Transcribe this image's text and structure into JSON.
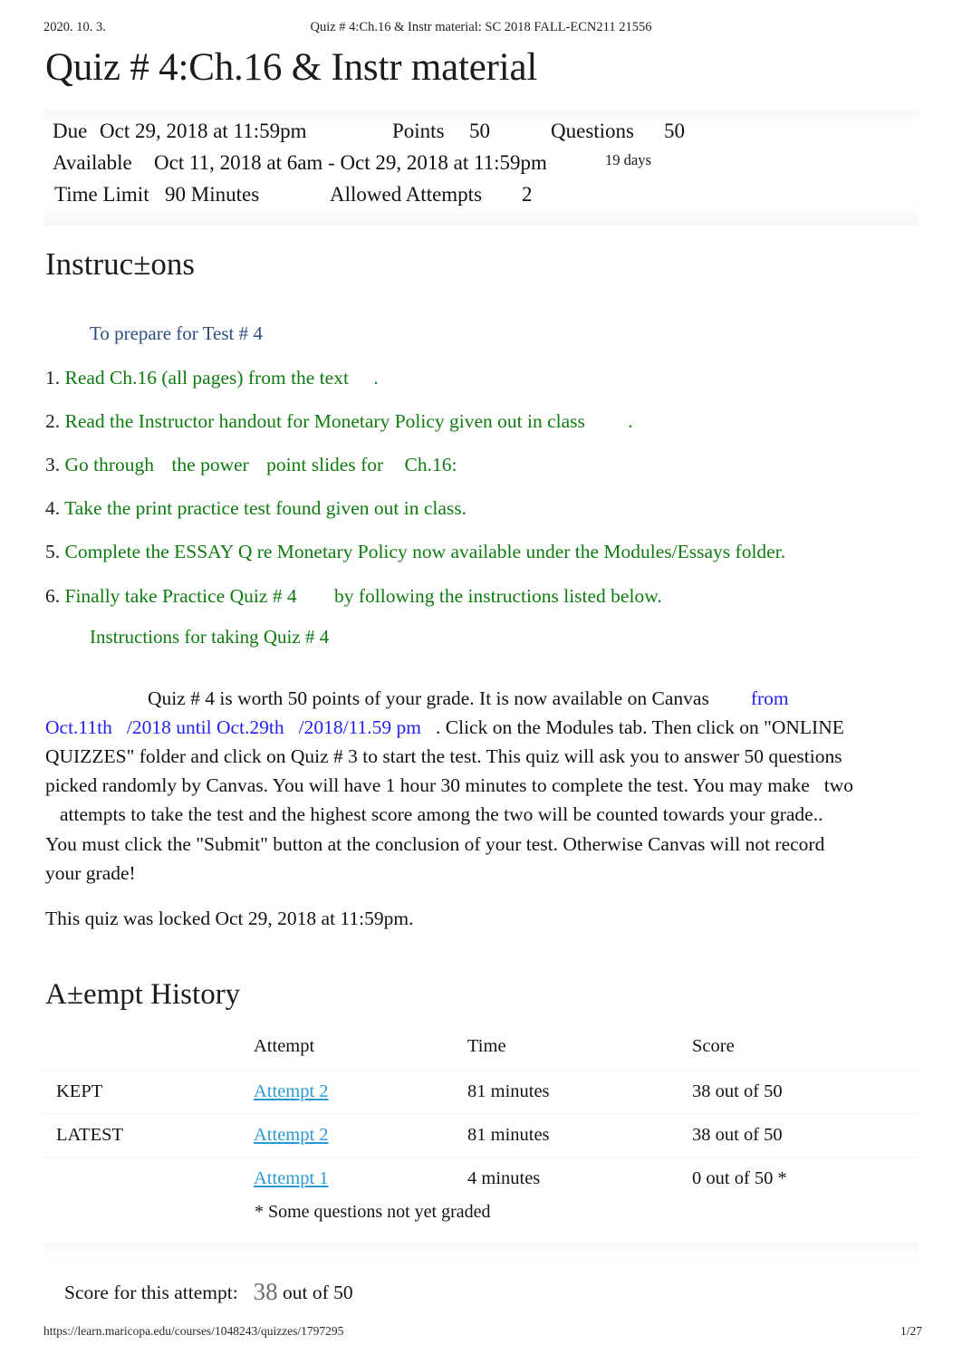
{
  "print_header": {
    "date": "2020. 10. 3.",
    "doc_title": "Quiz # 4:Ch.16 & Instr material: SC 2018 FALL-ECN211 21556"
  },
  "quiz": {
    "title": "Quiz # 4:Ch.16 & Instr material"
  },
  "details": {
    "due_label": "Due",
    "due_value": "Oct 29, 2018 at 11:59pm",
    "points_label": "Points",
    "points_value": "50",
    "questions_label": "Questions",
    "questions_value": "50",
    "available_label": "Available",
    "available_value": "Oct 11, 2018 at 6am - Oct 29, 2018 at 11:59pm",
    "available_duration": "19 days",
    "time_limit_label": "Time Limit",
    "time_limit_value": "90 Minutes",
    "allowed_attempts_label": "Allowed Attempts",
    "allowed_attempts_value": "2"
  },
  "instructions": {
    "heading": "Instruc±ons",
    "prepare_line": "To prepare for Test # 4",
    "items": [
      {
        "num": "1.",
        "text": "Read Ch.16 (all pages) from the text",
        "trailing": "."
      },
      {
        "num": "2.",
        "text": "Read the Instructor handout for Monetary Policy given out in class",
        "trailing": "."
      },
      {
        "num": "3.",
        "text_a": "Go through",
        "text_b": "the power",
        "text_c": "point slides for",
        "text_d": "Ch.16:"
      },
      {
        "num": "4.",
        "text": "Take the print practice test found given out in class.",
        "trailing": ""
      },
      {
        "num": "5.",
        "text": "Complete the ESSAY Q re Monetary Policy now available under the Modules/Essays folder.",
        "trailing": ""
      },
      {
        "num": "6.",
        "text": "Finally take Practice Quiz # 4",
        "trailing_text": "by following the instructions listed below."
      }
    ],
    "taking_heading": "Instructions for taking Quiz # 4",
    "paragraph": {
      "part1": "Quiz # 4 is worth 50 points of your grade. It is now available on Canvas",
      "link1": "from",
      "link2": "Oct.11th",
      "link3": "/2018 until Oct.29th",
      "link4": "/2018/11.59 pm",
      "part2": ". Click on the Modules tab. Then click on \"ONLINE QUIZZES\" folder and click on Quiz # 3 to start the test. This quiz will ask you to answer 50 questions picked randomly by Canvas. You will have 1 hour 30 minutes to complete the test. You may make",
      "part3": "two",
      "part4": "attempts to take the test and the highest score among the two will be counted towards your grade..",
      "part5": "You must click the \"Submit\" button at the conclusion of your test. Otherwise Canvas will not record your grade!"
    },
    "locked_note": "This quiz was locked Oct 29, 2018 at 11:59pm."
  },
  "attempt_history": {
    "heading": "A±empt History",
    "columns": [
      "",
      "Attempt",
      "Time",
      "Score"
    ],
    "rows": [
      {
        "kept": "KEPT",
        "attempt": "Attempt 2",
        "time": "81 minutes",
        "score": "38 out of 50"
      },
      {
        "kept": "LATEST",
        "attempt": "Attempt 2",
        "time": "81 minutes",
        "score": "38 out of 50"
      },
      {
        "kept": "",
        "attempt": "Attempt 1",
        "time": "4 minutes",
        "score": "0 out of 50 *"
      }
    ],
    "footnote": "* Some questions not yet graded"
  },
  "score_summary": {
    "label": "Score for this attempt:",
    "value": "38",
    "suffix": "out of 50"
  },
  "footer": {
    "url": "https://learn.maricopa.edu/courses/1048243/quizzes/1797295",
    "page": "1/27"
  },
  "colors": {
    "green": "#0f7a10",
    "link_blue": "#2323ee",
    "heading_blue": "#2d4f86",
    "canvas_link": "#2b9ad6"
  }
}
